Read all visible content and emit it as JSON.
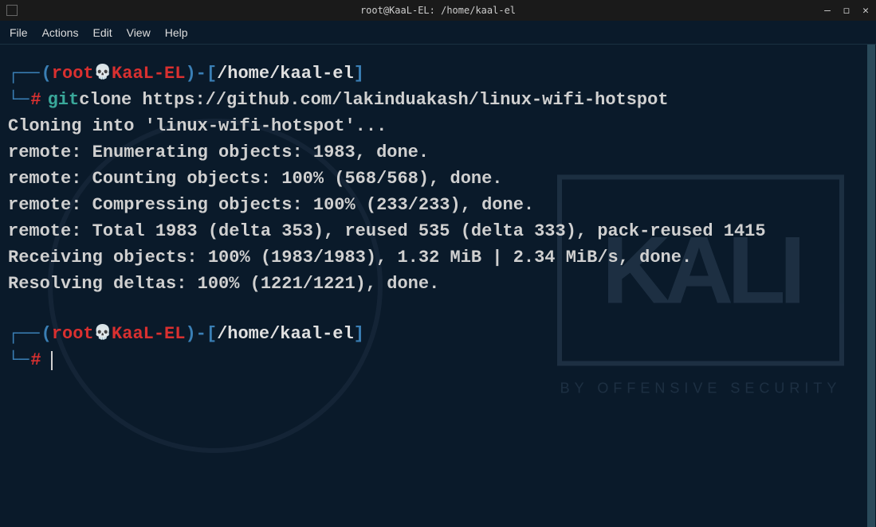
{
  "window": {
    "title": "root@KaaL-EL: /home/kaal-el"
  },
  "menubar": {
    "items": [
      "File",
      "Actions",
      "Edit",
      "View",
      "Help"
    ]
  },
  "prompt1": {
    "user": "root",
    "host": "KaaL-EL",
    "path": "/home/kaal-el"
  },
  "command1": {
    "cmd": "git",
    "args": " clone https://github.com/lakinduakash/linux-wifi-hotspot"
  },
  "output": {
    "lines": [
      "Cloning into 'linux-wifi-hotspot'...",
      "remote: Enumerating objects: 1983, done.",
      "remote: Counting objects: 100% (568/568), done.",
      "remote: Compressing objects: 100% (233/233), done.",
      "remote: Total 1983 (delta 353), reused 535 (delta 333), pack-reused 1415",
      "Receiving objects: 100% (1983/1983), 1.32 MiB | 2.34 MiB/s, done.",
      "Resolving deltas: 100% (1221/1221), done."
    ]
  },
  "prompt2": {
    "user": "root",
    "host": "KaaL-EL",
    "path": "/home/kaal-el"
  },
  "watermark": {
    "logo": "KALI",
    "tagline": "BY OFFENSIVE SECURITY"
  }
}
